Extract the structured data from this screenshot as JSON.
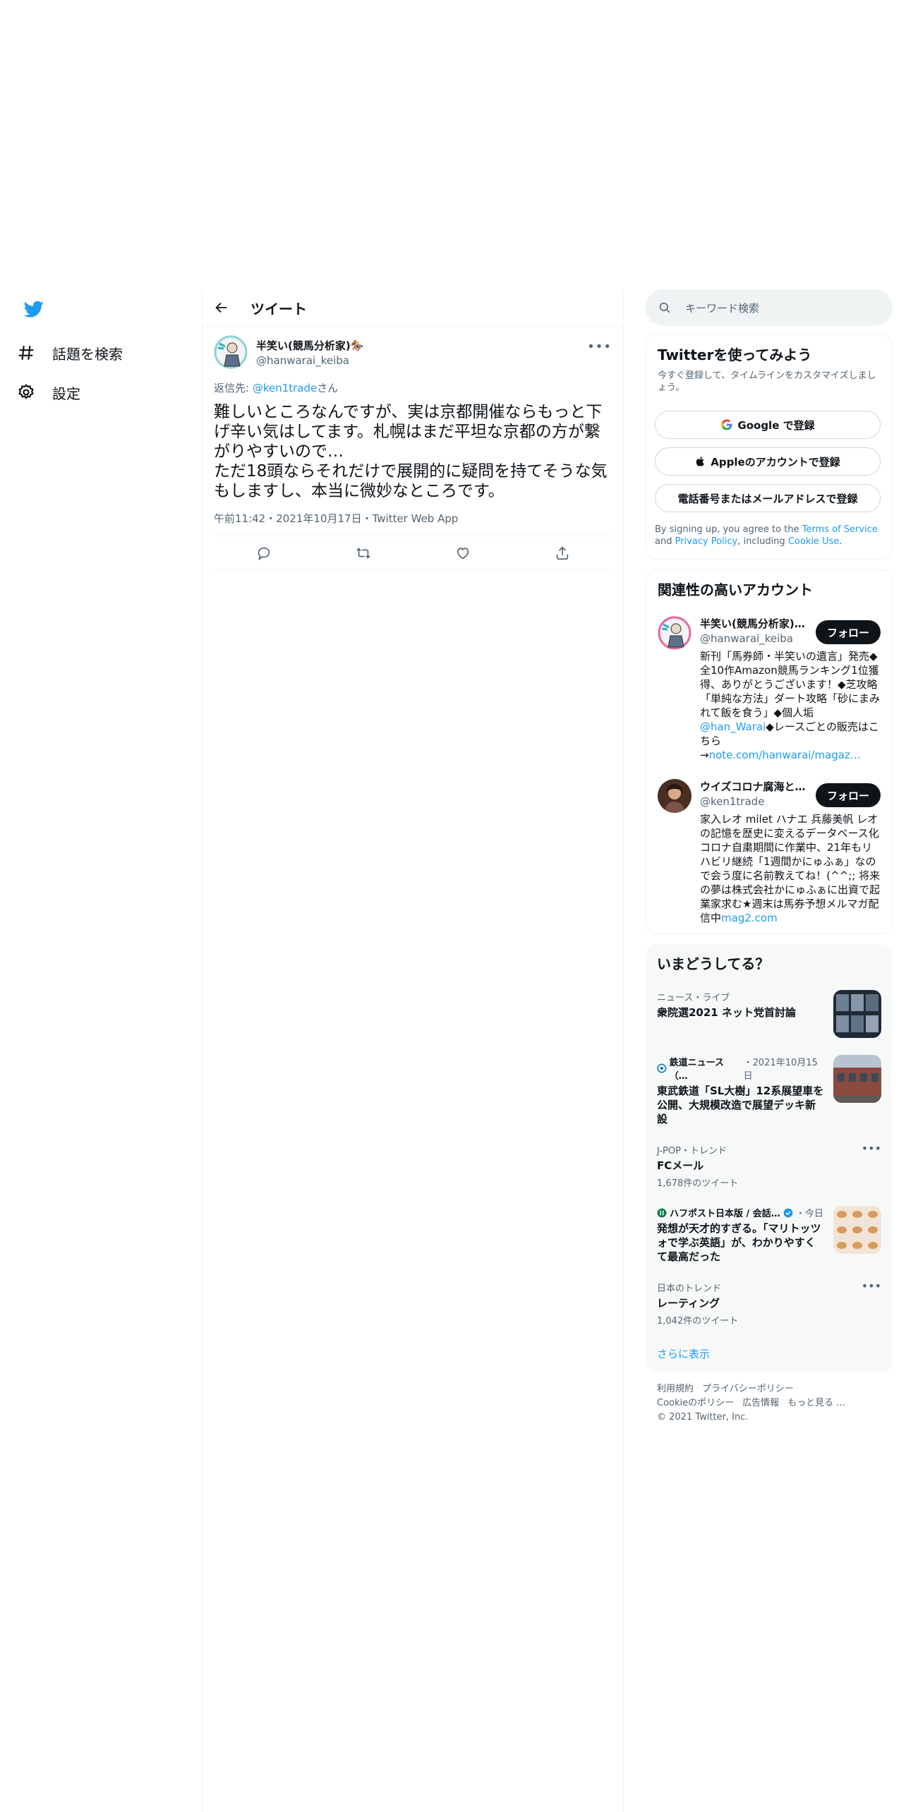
{
  "nav": {
    "explore": "話題を検索",
    "settings": "設定"
  },
  "main": {
    "title": "ツイート",
    "author_name": "半笑い(競馬分析家)🏇",
    "author_handle": "@hanwarai_keiba",
    "reply_prefix": "返信先: ",
    "reply_handle": "@ken1trade",
    "reply_suffix": "さん",
    "text": "難しいところなんですが、実は京都開催ならもっと下げ辛い気はしてます。札幌はまだ平坦な京都の方が繋がりやすいので…\nただ18頭ならそれだけで展開的に疑問を持てそうな気もしますし、本当に微妙なところです。",
    "meta": "午前11:42・2021年10月17日・Twitter Web App"
  },
  "search": {
    "placeholder": "キーワード検索"
  },
  "signup": {
    "title": "Twitterを使ってみよう",
    "subtitle": "今すぐ登録して、タイムラインをカスタマイズしましょう。",
    "google": "Google で登録",
    "apple": "Appleのアカウントで登録",
    "phone": "電話番号またはメールアドレスで登録",
    "legal_1": "By signing up, you agree to the ",
    "terms": "Terms of Service",
    "legal_2": " and ",
    "privacy": "Privacy Policy",
    "legal_3": ", including ",
    "cookie": "Cookie Use",
    "legal_4": "."
  },
  "related": {
    "title": "関連性の高いアカウント",
    "follow": "フォロー",
    "accounts": [
      {
        "name": "半笑い(競馬分析家)🏇",
        "handle": "@hanwarai_keiba",
        "bio": "新刊「馬券師・半笑いの遺言」発売◆全10作Amazon競馬ランキング1位獲得、ありがとうございます！◆芝攻略「単純な方法」ダート攻略「砂にまみれて飯を食う」◆個人垢",
        "bio_link": "@han_Warai",
        "bio_2": "◆レースごとの販売はこちら→",
        "bio_link_2": "note.com/hanwarai/magaz…"
      },
      {
        "name": "ウイズコロナ腐海と…",
        "handle": "@ken1trade",
        "bio": "家入レオ milet ハナエ 兵藤美帆 レオの記憶を歴史に変えるデータベース化 コロナ自粛期間に作業中、21年もリハビリ継続「1週間かにゅふぁ」なので会う度に名前教えてね！(^^;; 将来の夢は株式会社かにゅふぁに出資で起業家求む★週末は馬券予想メルマガ配信中",
        "bio_link": "mag2.com"
      }
    ]
  },
  "trends": {
    "title": "いまどうしてる？",
    "items": [
      {
        "category": "ニュース・ライブ",
        "title": "衆院選2021 ネット党首討論"
      },
      {
        "source": "鉄道ニュース（…",
        "date": "・2021年10月15日",
        "title": "東武鉄道「SL大樹」12系展望車を公開、大規模改造で展望デッキ新設"
      },
      {
        "category": "J-POP・トレンド",
        "title": "FCメール",
        "count": "1,678件のツイート"
      },
      {
        "source": "ハフポスト日本版 / 会話…",
        "date": "・今日",
        "title": "発想が天才的すぎる。「マリトッツォで学ぶ英語」が、わかりやすくて最高だった"
      },
      {
        "category": "日本のトレンド",
        "title": "レーティング",
        "count": "1,042件のツイート"
      }
    ],
    "show_more": "さらに表示"
  },
  "footer": {
    "terms": "利用規約",
    "privacy": "プライバシーポリシー",
    "cookie": "Cookieのポリシー",
    "ads": "広告情報",
    "more": "もっと見る …",
    "copyright": "© 2021 Twitter, Inc."
  },
  "colors": {
    "accent": "#1d9bf0",
    "text": "#0f1419",
    "muted": "#536471"
  }
}
